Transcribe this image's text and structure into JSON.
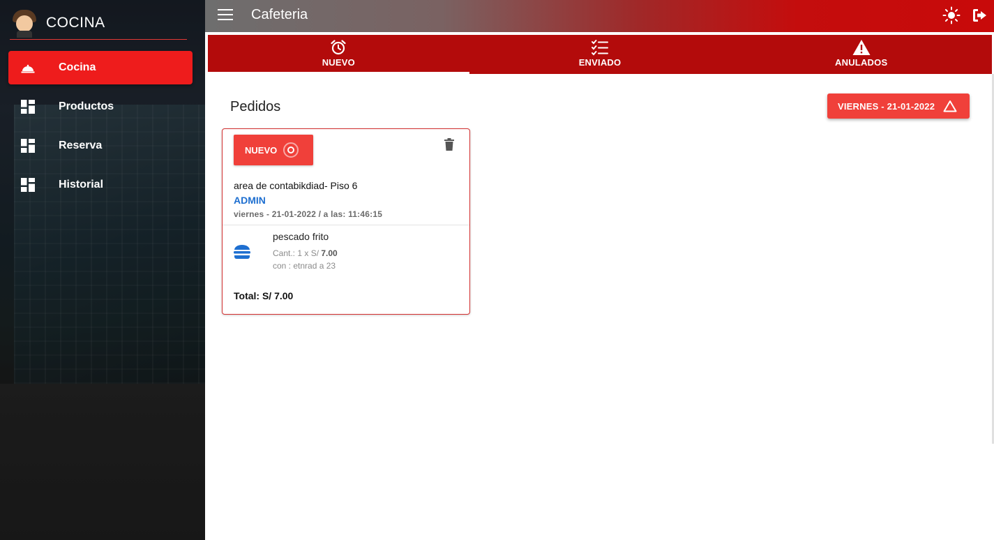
{
  "sidebar": {
    "brand": "COCINA",
    "items": [
      {
        "label": "Cocina",
        "icon": "cloche-icon",
        "active": true
      },
      {
        "label": "Productos",
        "icon": "dashboard-icon"
      },
      {
        "label": "Reserva",
        "icon": "dashboard-icon"
      },
      {
        "label": "Historial",
        "icon": "dashboard-icon"
      }
    ]
  },
  "header": {
    "title": "Cafeteria",
    "menu_icon": "menu-icon",
    "theme_icon": "sun-icon",
    "logout_icon": "logout-icon"
  },
  "tabs": [
    {
      "label": "NUEVO",
      "icon": "alarm-clock-icon",
      "active": true
    },
    {
      "label": "ENVIADO",
      "icon": "checklist-icon"
    },
    {
      "label": "ANULADOS",
      "icon": "warning-icon"
    }
  ],
  "main": {
    "title": "Pedidos",
    "date_button": "VIERNES - 21-01-2022"
  },
  "order": {
    "status": "NUEVO",
    "place": "area de contabikdiad- Piso 6",
    "user": "ADMIN",
    "timestamp": "viernes - 21-01-2022 / a las: 11:46:15",
    "item": {
      "name": "pescado frito",
      "qty_prefix": "Cant.: 1 x S/ ",
      "price": "7.00",
      "note": "con : etnrad a 23"
    },
    "total": "Total: S/ 7.00"
  },
  "colors": {
    "accent": "#ee1c1c",
    "tab_bar": "#b30b0b",
    "chip": "#f0403a",
    "user_link": "#1e6fd0"
  }
}
